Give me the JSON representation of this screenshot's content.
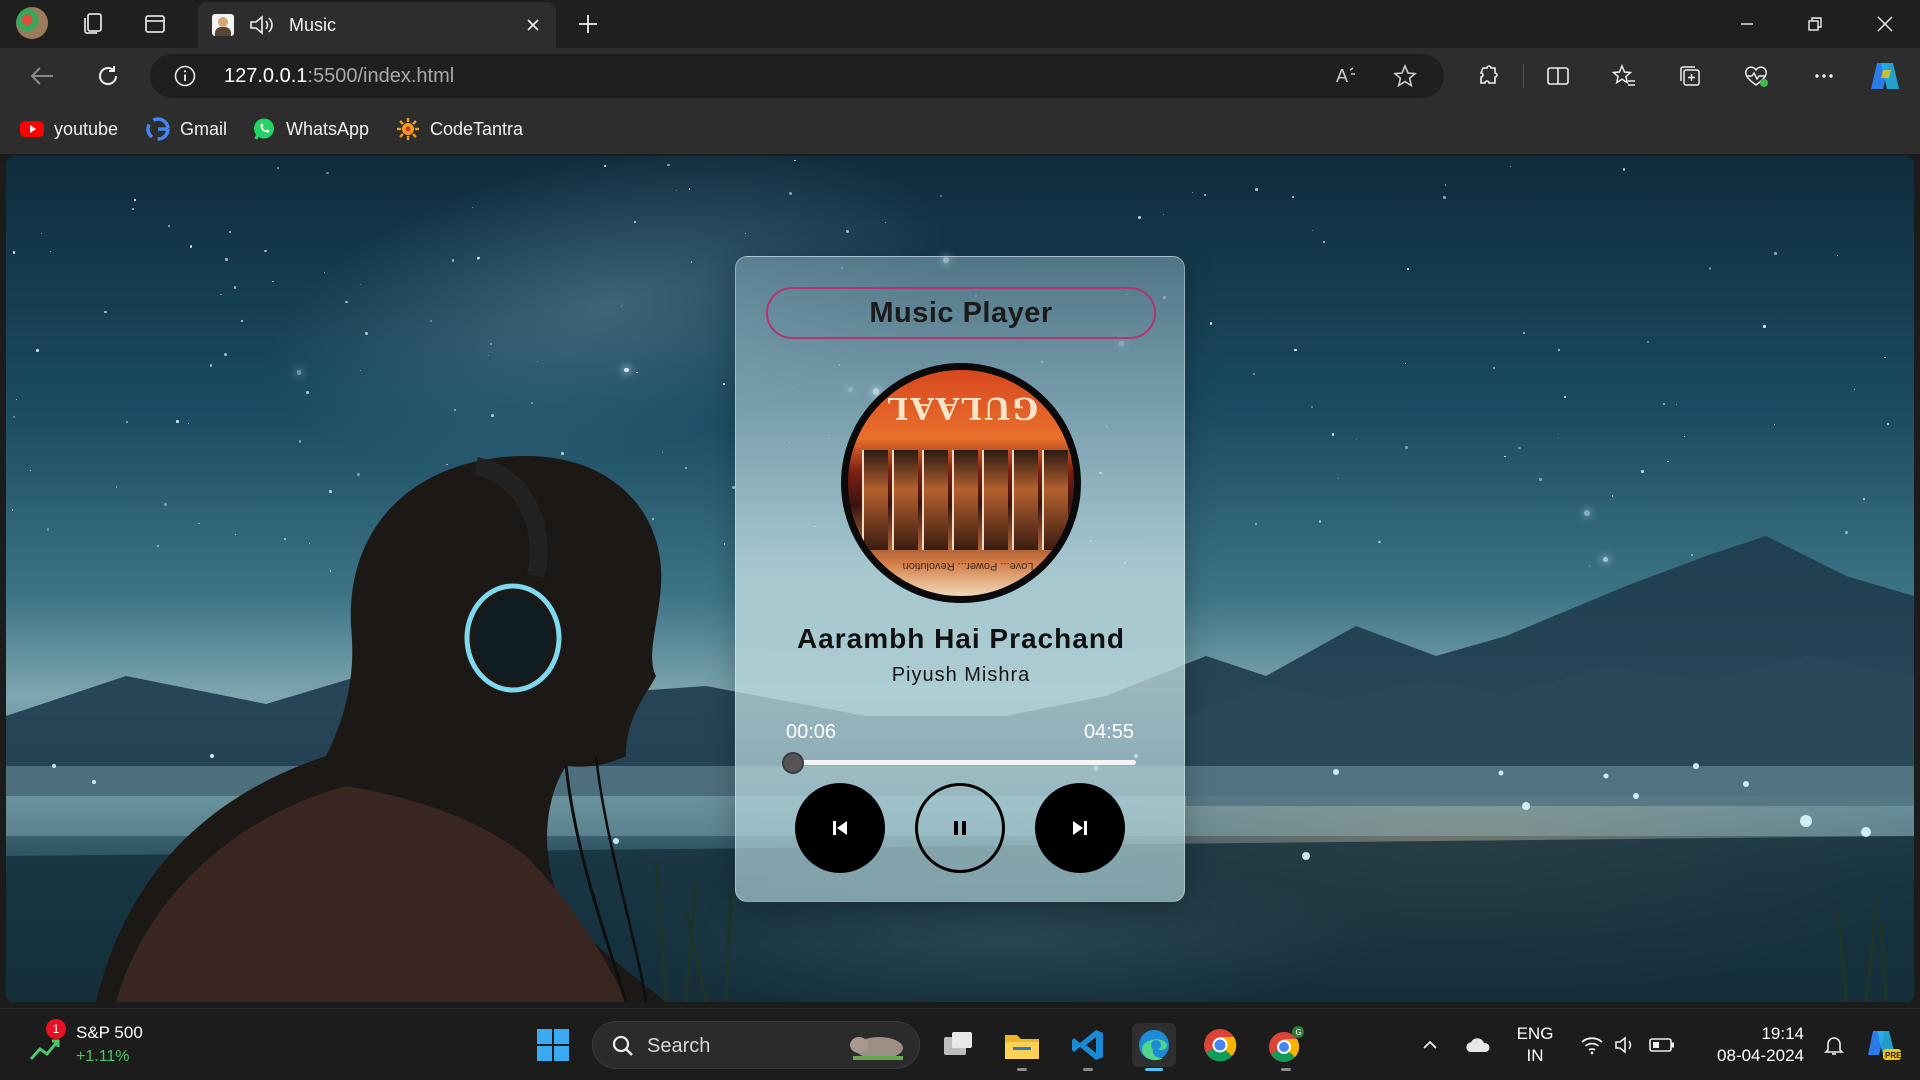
{
  "browser": {
    "tab": {
      "title": "Music"
    },
    "address": {
      "host": "127.0.0.1",
      "rest": ":5500/index.html"
    },
    "bookmarks": [
      {
        "label": "youtube",
        "icon": "youtube-icon"
      },
      {
        "label": "Gmail",
        "icon": "google-icon"
      },
      {
        "label": "WhatsApp",
        "icon": "whatsapp-icon"
      },
      {
        "label": "CodeTantra",
        "icon": "codetantra-icon"
      }
    ]
  },
  "player": {
    "title": "Music Player",
    "cover_title": "GULAAL",
    "cover_tagline": "Love... Power... Revolution",
    "song": "Aarambh Hai Prachand",
    "artist": "Piyush Mishra",
    "current_time": "00:06",
    "total_time": "04:55",
    "progress_fraction": 0.02,
    "state": "playing"
  },
  "taskbar": {
    "widget": {
      "name": "S&P 500",
      "change": "+1.11%",
      "badge": "1"
    },
    "search_placeholder": "Search",
    "lang": {
      "line1": "ENG",
      "line2": "IN"
    },
    "clock": {
      "time": "19:14",
      "date": "08-04-2024"
    },
    "apps": [
      "task-view",
      "file-explorer",
      "vscode",
      "edge",
      "chrome",
      "chrome-profile"
    ]
  },
  "colors": {
    "title_border": "#b5336e",
    "accent_blue": "#4cc2ff"
  }
}
